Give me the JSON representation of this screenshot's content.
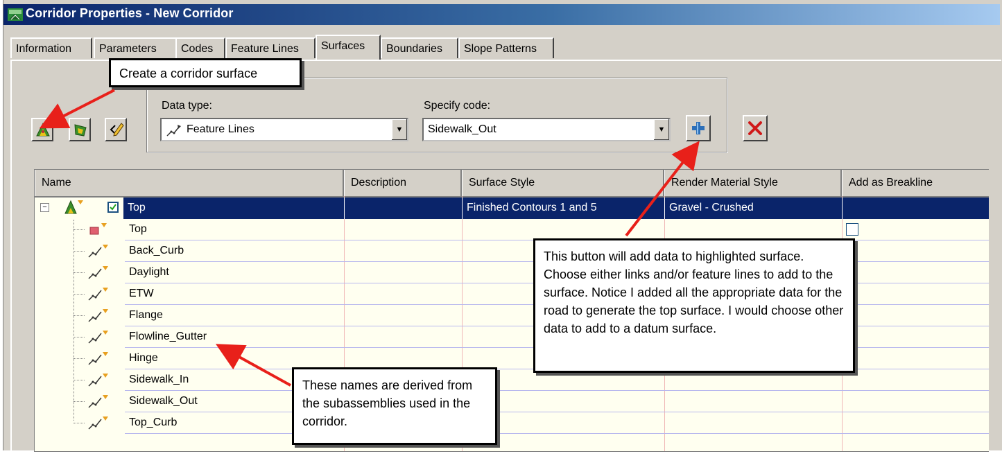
{
  "window": {
    "title": "Corridor Properties - New Corridor",
    "colors": {
      "title_start": "#0a246a",
      "title_end": "#a6caf0",
      "selection": "#0a246a",
      "arrow": "#e8201a"
    }
  },
  "tabs": [
    {
      "label": "Information"
    },
    {
      "label": "Parameters"
    },
    {
      "label": "Codes"
    },
    {
      "label": "Feature Lines"
    },
    {
      "label": "Surfaces",
      "active": true
    },
    {
      "label": "Boundaries"
    },
    {
      "label": "Slope Patterns"
    }
  ],
  "toolbar": {
    "create_surface_icon": "create-corridor-surface-icon",
    "create_from_icon": "create-surface-from-icon",
    "edit_icon": "edit-pencil-icon"
  },
  "data_type": {
    "label": "Data type:",
    "value": "Feature Lines",
    "icon": "feature-line-icon"
  },
  "specify_code": {
    "label": "Specify code:",
    "value": "Sidewalk_Out"
  },
  "add_button_icon": "plus-icon",
  "delete_button_icon": "red-x-icon",
  "grid": {
    "columns": [
      "Name",
      "Description",
      "Surface Style",
      "Render Material Style",
      "Add as Breakline"
    ],
    "surface": {
      "name": "Top",
      "description": "",
      "surface_style": "Finished Contours 1 and 5",
      "render_material": "Gravel - Crushed",
      "checked": true
    },
    "children": [
      {
        "name": "Top",
        "icon": "link-icon",
        "breakline_checkbox": true
      },
      {
        "name": "Back_Curb",
        "icon": "feature-line-icon"
      },
      {
        "name": "Daylight",
        "icon": "feature-line-icon"
      },
      {
        "name": "ETW",
        "icon": "feature-line-icon"
      },
      {
        "name": "Flange",
        "icon": "feature-line-icon"
      },
      {
        "name": "Flowline_Gutter",
        "icon": "feature-line-icon"
      },
      {
        "name": "Hinge",
        "icon": "feature-line-icon"
      },
      {
        "name": "Sidewalk_In",
        "icon": "feature-line-icon"
      },
      {
        "name": "Sidewalk_Out",
        "icon": "feature-line-icon"
      },
      {
        "name": "Top_Curb",
        "icon": "feature-line-icon"
      }
    ]
  },
  "callouts": {
    "create": "Create a corridor surface",
    "add_data": "This button will add data to highlighted surface.  Choose either links and/or feature lines to add to the surface.  Notice I added all the appropriate data for the road to generate the top surface.  I would choose other data to add to a datum surface.",
    "names": "These names are derived from the subassemblies used in the corridor."
  }
}
